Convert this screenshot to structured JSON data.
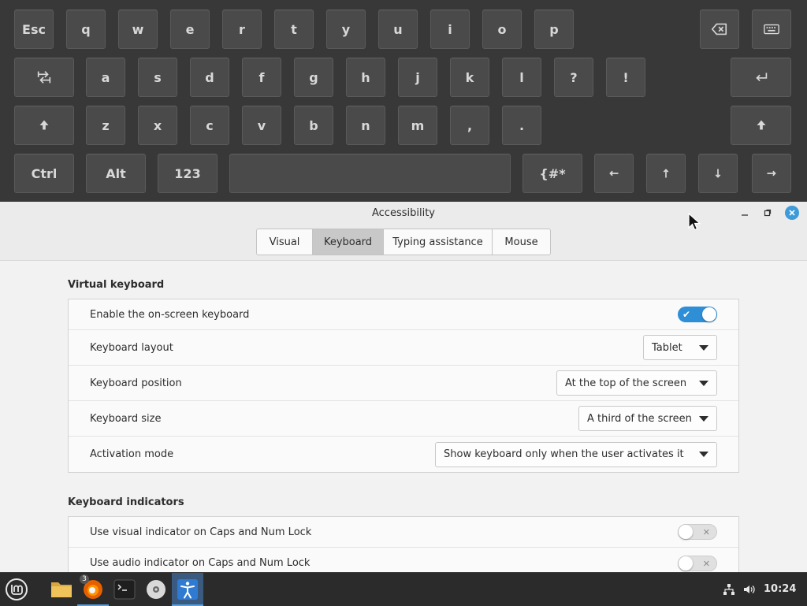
{
  "keyboard": {
    "row1": [
      "Esc",
      "q",
      "w",
      "e",
      "r",
      "t",
      "y",
      "u",
      "i",
      "o",
      "p"
    ],
    "row2": [
      "a",
      "s",
      "d",
      "f",
      "g",
      "h",
      "j",
      "k",
      "l",
      "?",
      "!"
    ],
    "row3": [
      "z",
      "x",
      "c",
      "v",
      "b",
      "n",
      "m",
      ",",
      "."
    ],
    "row4": {
      "ctrl": "Ctrl",
      "alt": "Alt",
      "num": "123",
      "symbols": "{#*"
    },
    "icons": {
      "backspace": "backspace-icon",
      "hide": "keyboard-icon",
      "tab": "tab-icon",
      "enter": "enter-icon",
      "shift": "shift-icon",
      "left": "arrow-left-icon",
      "up": "arrow-up-icon",
      "down": "arrow-down-icon",
      "right": "arrow-right-icon"
    }
  },
  "window": {
    "title": "Accessibility",
    "tabs": [
      "Visual",
      "Keyboard",
      "Typing assistance",
      "Mouse"
    ],
    "active_tab": "Keyboard"
  },
  "virtual_keyboard": {
    "title": "Virtual keyboard",
    "enable_label": "Enable the on-screen keyboard",
    "enable_on": true,
    "layout_label": "Keyboard layout",
    "layout_value": "Tablet",
    "position_label": "Keyboard position",
    "position_value": "At the top of the screen",
    "size_label": "Keyboard size",
    "size_value": "A third of the screen",
    "activation_label": "Activation mode",
    "activation_value": "Show keyboard only when the user activates it"
  },
  "keyboard_indicators": {
    "title": "Keyboard indicators",
    "visual_label": "Use visual indicator on Caps and Num Lock",
    "visual_on": false,
    "audio_label": "Use audio indicator on Caps and Num Lock",
    "audio_on": false
  },
  "taskbar": {
    "badge": "3",
    "clock": "10:24"
  },
  "colors": {
    "accent": "#2e8ed6",
    "keyboard_bg": "#383838",
    "key_bg": "#4a4a4a",
    "taskbar_bg": "#2b2b2b"
  }
}
